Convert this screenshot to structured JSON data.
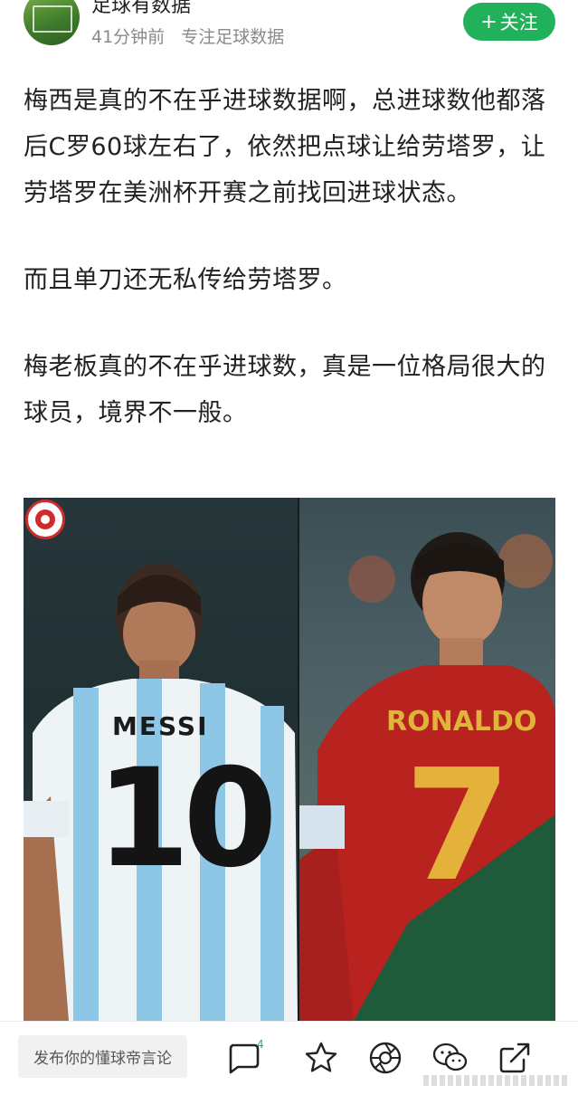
{
  "header": {
    "author_name": "足球有数据",
    "time_ago": "41分钟前",
    "tagline": "专注足球数据",
    "follow_plus": "+",
    "follow_label": "关注"
  },
  "post": {
    "paragraphs": [
      "梅西是真的不在乎进球数据啊，总进球数他都落后C罗60球左右了，依然把点球让给劳塔罗，让劳塔罗在美洲杯开赛之前找回进球状态。",
      "而且单刀还无私传给劳塔罗。",
      "梅老板真的不在乎进球数，真是一位格局很大的球员，境界不一般。"
    ]
  },
  "photo": {
    "left_jersey_name": "MESSI",
    "left_jersey_number": "10",
    "right_jersey_name": "RONALDO",
    "right_jersey_number": "7"
  },
  "bottom_bar": {
    "comment_placeholder": "发布你的懂球帝言论",
    "comment_count": "4"
  },
  "colors": {
    "accent": "#21b15a",
    "logo_red": "#d02b2b"
  },
  "icons": [
    "comment-icon",
    "star-icon",
    "camera-shutter-icon",
    "wechat-icon",
    "share-icon"
  ]
}
